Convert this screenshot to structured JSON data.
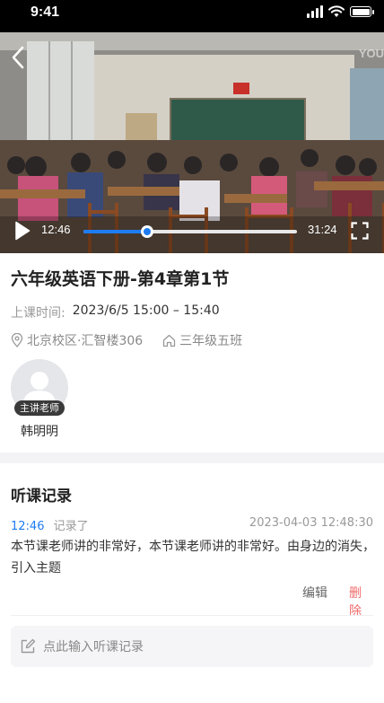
{
  "status_bar": {
    "time": "9:41"
  },
  "video": {
    "watermark": "YOU",
    "current_time": "12:46",
    "total_time": "31:24",
    "progress": 0.3
  },
  "lesson": {
    "title": "六年级英语下册-第4章第1节",
    "time_label": "上课时间:",
    "time_value": "2023/6/5  15:00 – 15:40",
    "location": "北京校区·汇智楼306",
    "class_name": "三年级五班"
  },
  "teacher": {
    "role_tag": "主讲老师",
    "name": "韩明明"
  },
  "notes": {
    "section_title": "听课记录",
    "items": [
      {
        "timestamp": "12:46",
        "recorded_label": "记录了",
        "date": "2023-04-03  12:48:30",
        "content": "本节课老师讲的非常好，本节课老师讲的非常好。由身边的消失，引入主题",
        "edit_label": "编辑",
        "delete_label": "删除"
      }
    ],
    "input_placeholder": "点此输入听课记录"
  },
  "colors": {
    "accent": "#1e7cf2",
    "delete": "#f06a6a"
  },
  "icons": [
    "back-icon",
    "play-icon",
    "fullscreen-icon",
    "location-icon",
    "home-icon",
    "edit-icon",
    "user-avatar-icon"
  ]
}
